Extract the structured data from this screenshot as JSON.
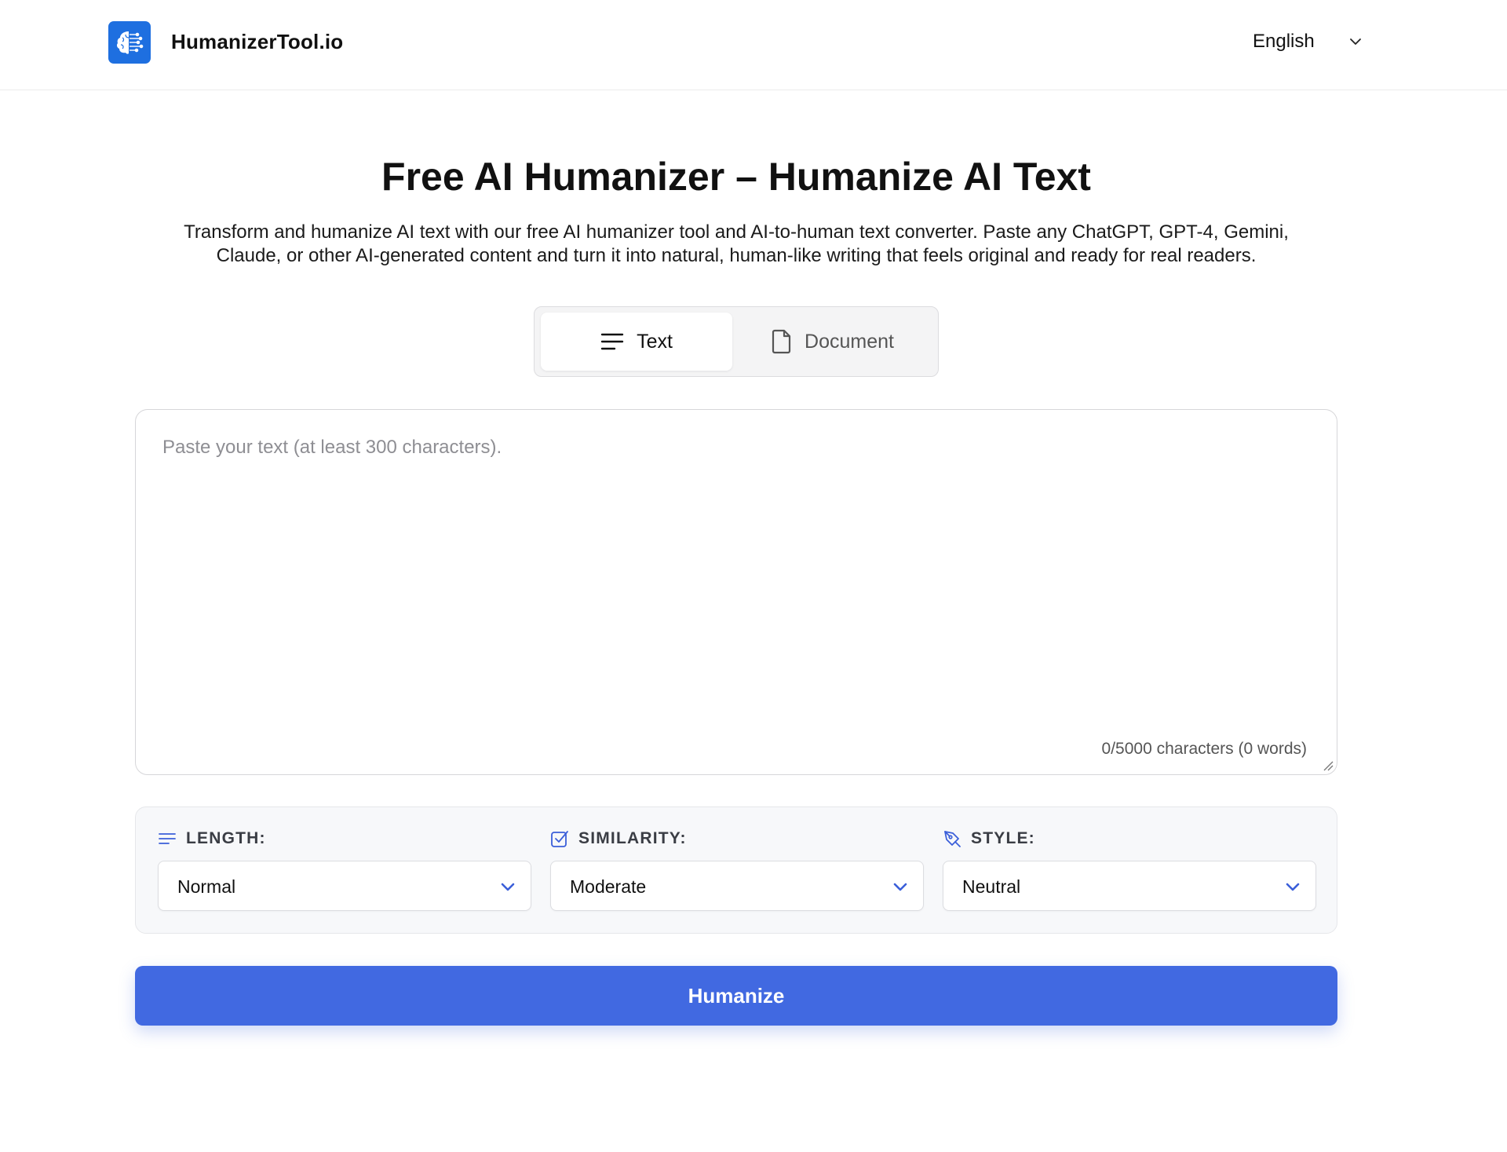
{
  "header": {
    "brand": "HumanizerTool.io",
    "language": "English"
  },
  "hero": {
    "title": "Free AI Humanizer – Humanize AI Text",
    "subtitle": "Transform and humanize AI text with our free AI humanizer tool and AI-to-human text converter. Paste any ChatGPT, GPT-4, Gemini, Claude, or other AI-generated content and turn it into natural, human-like writing that feels original and ready for real readers."
  },
  "tabs": [
    {
      "label": "Text",
      "icon": "lines-icon",
      "active": true
    },
    {
      "label": "Document",
      "icon": "document-icon",
      "active": false
    }
  ],
  "editor": {
    "value": "",
    "placeholder": "Paste your text (at least 300 characters).",
    "counter": "0/5000 characters (0 words)"
  },
  "options": {
    "length": {
      "label": "LENGTH:",
      "value": "Normal",
      "icon": "lines-icon"
    },
    "similarity": {
      "label": "SIMILARITY:",
      "value": "Moderate",
      "icon": "checkbox-icon"
    },
    "style": {
      "label": "STYLE:",
      "value": "Neutral",
      "icon": "pen-tool-icon"
    }
  },
  "actions": {
    "humanize": "Humanize"
  },
  "colors": {
    "brand_blue": "#1e6fe0",
    "accent": "#4169e1",
    "icon_blue": "#3b5fd9"
  }
}
